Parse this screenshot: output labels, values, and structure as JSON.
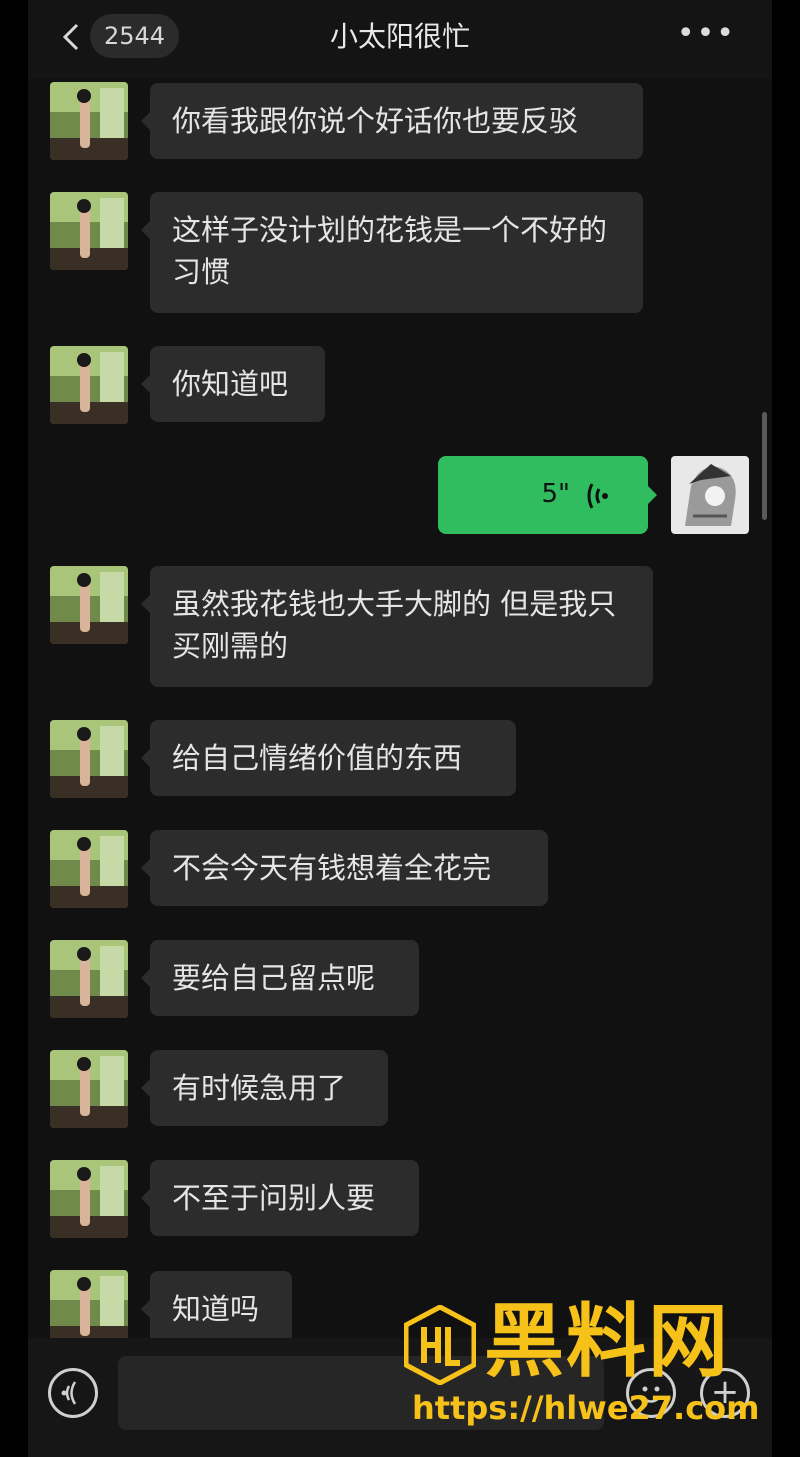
{
  "header": {
    "back_icon": "chevron-left-icon",
    "unread_count": "2544",
    "title": "小太阳很忙",
    "more_icon": "more-dots-icon"
  },
  "messages": [
    {
      "side": "left",
      "text": "你看我跟你说个好话你也要反驳"
    },
    {
      "side": "left",
      "text": "这样子没计划的花钱是一个不好的习惯"
    },
    {
      "side": "left",
      "text": "你知道吧"
    },
    {
      "side": "right",
      "type": "voice",
      "duration": "5\""
    },
    {
      "side": "left",
      "text": "虽然我花钱也大手大脚的 但是我只买刚需的"
    },
    {
      "side": "left",
      "text": "给自己情绪价值的东西"
    },
    {
      "side": "left",
      "text": "不会今天有钱想着全花完"
    },
    {
      "side": "left",
      "text": "要给自己留点呢"
    },
    {
      "side": "left",
      "text": "有时候急用了"
    },
    {
      "side": "left",
      "text": "不至于问别人要"
    },
    {
      "side": "left",
      "text": "知道吗"
    }
  ],
  "composer": {
    "voice_icon": "voice-input-icon",
    "emoji_icon": "emoji-icon",
    "plus_icon": "plus-icon"
  },
  "watermark": {
    "brand": "黑料网",
    "url": "https://hlwe27.com",
    "color": "#f6c21a"
  }
}
